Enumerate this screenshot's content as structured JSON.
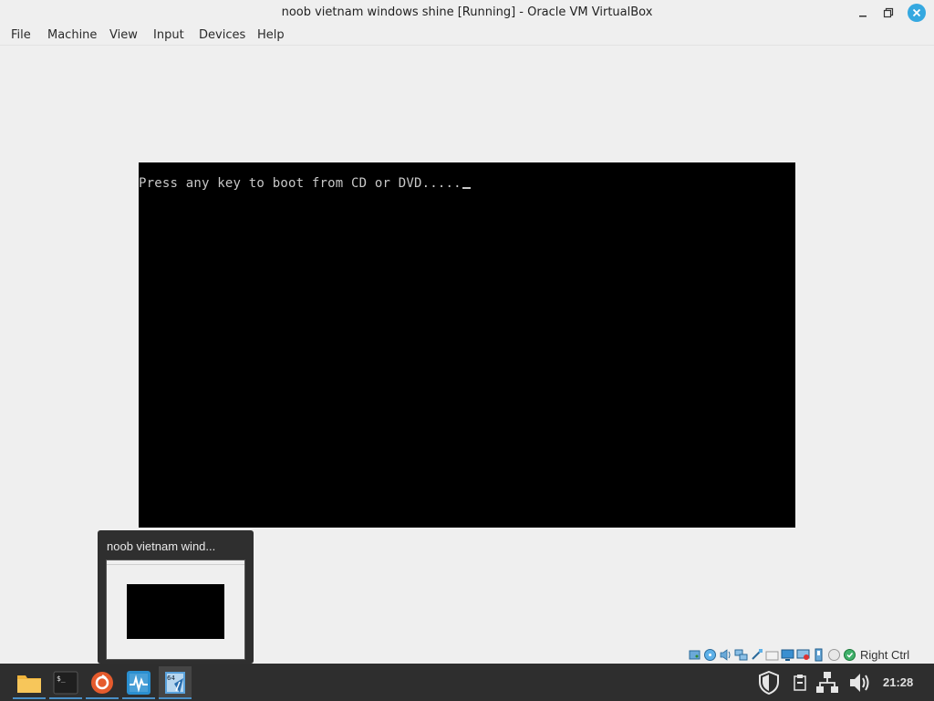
{
  "window": {
    "title": "noob vietnam windows shine [Running] - Oracle VM VirtualBox"
  },
  "menu": {
    "items": [
      {
        "label": "File"
      },
      {
        "label": "Machine"
      },
      {
        "label": "View"
      },
      {
        "label": "Input"
      },
      {
        "label": "Devices"
      },
      {
        "label": "Help"
      }
    ]
  },
  "vm": {
    "console_text": "Press any key to boot from CD or DVD.....",
    "screen_bg": "#000000",
    "text_color": "#c8c8c8"
  },
  "statusbar": {
    "icons": [
      "hard-disk-icon",
      "optical-drive-icon",
      "audio-icon",
      "network-icon",
      "usb-icon",
      "shared-folders-icon",
      "display-icon",
      "recording-icon",
      "cpu-icon",
      "mouse-integration-icon",
      "keyboard-icon"
    ],
    "host_key": "Right Ctrl"
  },
  "preview": {
    "title": "noob vietnam wind..."
  },
  "taskbar": {
    "apps": [
      "file-manager-icon",
      "terminal-icon",
      "firefox-icon",
      "system-monitor-icon",
      "virtualbox-icon"
    ],
    "tray": [
      "shield-icon",
      "clipboard-icon",
      "network-icon",
      "volume-icon"
    ],
    "clock": "21:28"
  },
  "colors": {
    "close_button": "#35a8e0",
    "taskbar_bg": "#2e2e2e",
    "window_bg": "#efefef"
  }
}
